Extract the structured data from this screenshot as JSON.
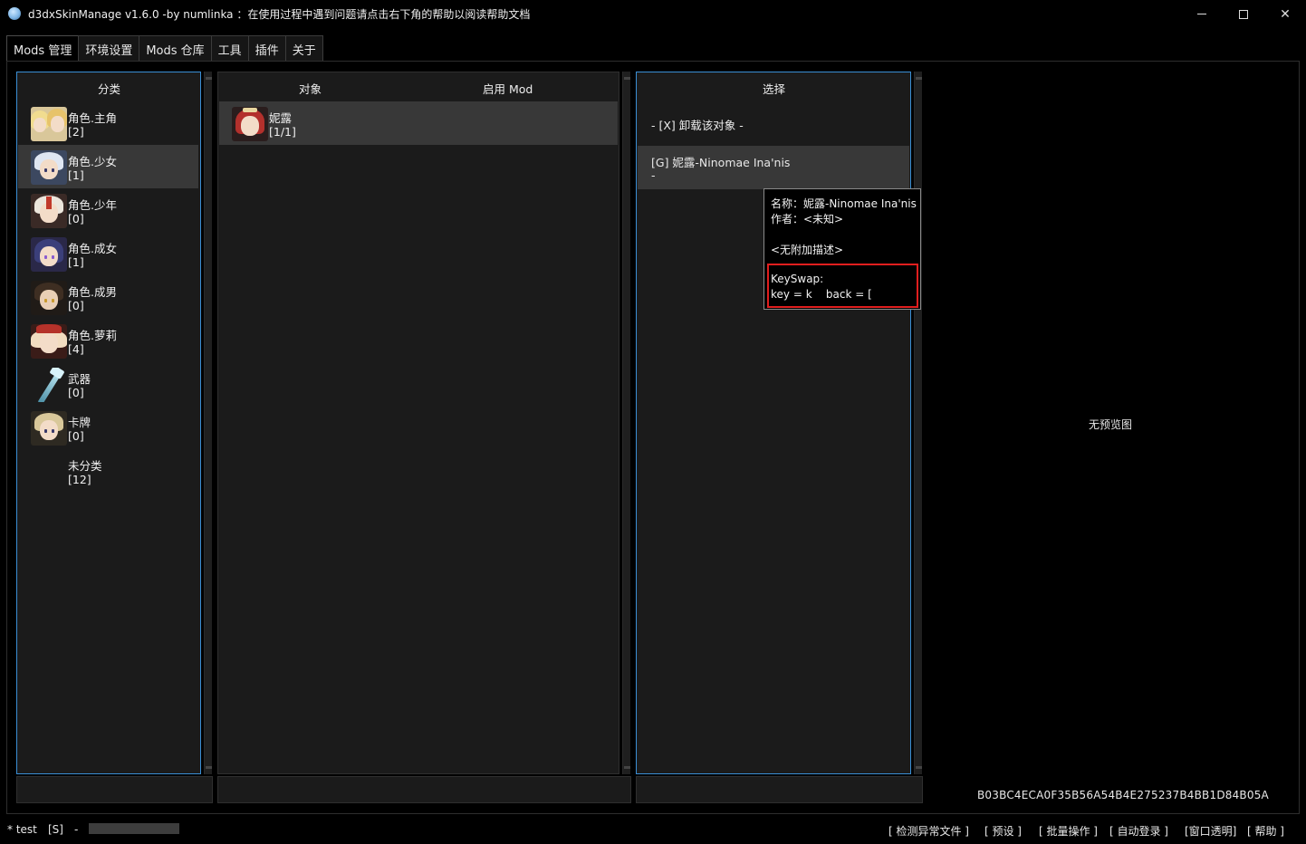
{
  "window": {
    "title": "d3dxSkinManage v1.6.0 -by numlinka ：在使用过程中遇到问题请点击右下角的帮助以阅读帮助文档",
    "minimize": "—",
    "maximize": "☐",
    "close": "✕"
  },
  "tabs": [
    {
      "label": "Mods 管理",
      "active": true
    },
    {
      "label": "环境设置"
    },
    {
      "label": "Mods 仓库"
    },
    {
      "label": "工具"
    },
    {
      "label": "插件"
    },
    {
      "label": "关于"
    }
  ],
  "category_panel": {
    "header": "分类",
    "items": [
      {
        "name": "角色.主角",
        "count": "[2]",
        "icon": "traveler-twins-avatar"
      },
      {
        "name": "角色.少女",
        "count": "[1]",
        "icon": "ayaka-avatar",
        "selected": true
      },
      {
        "name": "角色.少年",
        "count": "[0]",
        "icon": "kazuha-avatar"
      },
      {
        "name": "角色.成女",
        "count": "[1]",
        "icon": "raiden-avatar"
      },
      {
        "name": "角色.成男",
        "count": "[0]",
        "icon": "zhongli-avatar"
      },
      {
        "name": "角色.萝莉",
        "count": "[4]",
        "icon": "klee-avatar"
      },
      {
        "name": "武器",
        "count": "[0]",
        "icon": "spear-icon"
      },
      {
        "name": "卡牌",
        "count": "[0]",
        "icon": "card-avatar"
      },
      {
        "name": "未分类",
        "count": "[12]",
        "icon": ""
      }
    ]
  },
  "object_panel": {
    "header_object": "对象",
    "header_enabled": "启用 Mod",
    "items": [
      {
        "name": "妮露",
        "count": "[1/1]",
        "icon": "nilou-avatar"
      }
    ]
  },
  "select_panel": {
    "header": "选择",
    "unload_option": "- [X] 卸载该对象 -",
    "items": [
      {
        "name": "[G] 妮露-Ninomae Ina'nis",
        "sub": "-"
      }
    ]
  },
  "tooltip": {
    "name_line": "名称：妮露-Ninomae Ina'nis",
    "author_line": "作者：<未知>",
    "desc_line": "<无附加描述>",
    "keyswap_title": "KeySwap:",
    "keyswap_line": "key = k    back = ["
  },
  "preview": {
    "empty_text": "无预览图",
    "hash": "B03BC4ECA0F35B56A54B4E275237B4BB1D84B05A"
  },
  "statusbar": {
    "user": "* test",
    "flag": "[S]",
    "dash": "-",
    "links": [
      "[ 检测异常文件 ]",
      "[ 预设 ]",
      "[ 批量操作 ]",
      "[ 自动登录 ]",
      "[窗口透明]",
      "[ 帮助 ]"
    ]
  },
  "colors": {
    "accent": "#3a8fd6",
    "highlight_box": "#e01e1e",
    "selected_row": "#383838",
    "panel_bg": "#1b1b1b"
  }
}
